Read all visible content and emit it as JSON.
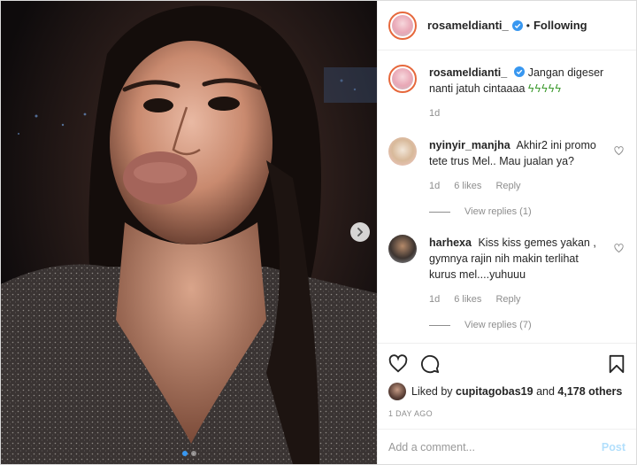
{
  "header": {
    "username": "rosameldianti_",
    "bullet": "•",
    "follow_state": "Following"
  },
  "caption": {
    "username": "rosameldianti_",
    "text": "Jangan digeser nanti jatuh cintaaaa",
    "emoji": "ϟϟϟϟϟ",
    "time": "1d"
  },
  "comments": [
    {
      "username": "nyinyir_manjha",
      "text": "Akhir2 ini promo tete trus Mel.. Mau jualan ya?",
      "time": "1d",
      "likes": "6 likes",
      "reply": "Reply",
      "view_replies": "View replies (1)"
    },
    {
      "username": "harhexa",
      "text": "Kiss kiss gemes yakan , gymnya rajin nih makin terlihat kurus mel....yuhuuu",
      "time": "1d",
      "likes": "6 likes",
      "reply": "Reply",
      "view_replies": "View replies (7)"
    }
  ],
  "likes_line": {
    "prefix": "Liked by",
    "user": "cupitagobas19",
    "and": "and",
    "others": "4,178 others"
  },
  "posted_ago": "1 DAY AGO",
  "add_comment": {
    "placeholder": "Add a comment...",
    "post_label": "Post"
  },
  "carousel": {
    "slides": 2,
    "active_index": 0
  },
  "icons": {
    "like": "heart-icon",
    "comment": "comment-bubble-icon",
    "save": "bookmark-icon",
    "next": "chevron-right-icon",
    "verified": "verified-badge-icon"
  },
  "colors": {
    "text": "#262626",
    "muted": "#8e8e8e",
    "verified_blue": "#3897f0",
    "post_disabled": "#b2dffc",
    "emoji_green": "#3d9a2e",
    "avatar_ring": "#e6683c"
  }
}
